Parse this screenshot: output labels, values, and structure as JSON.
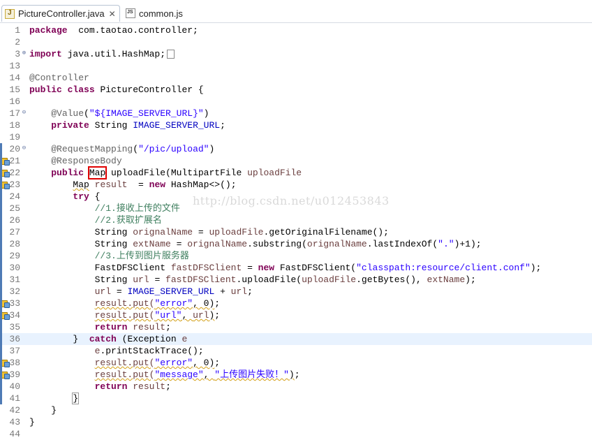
{
  "tabs": [
    {
      "label": "PictureController.java",
      "active": true,
      "icon": "java-file-icon",
      "close": "✕"
    },
    {
      "label": "common.js",
      "active": false,
      "icon": "js-file-icon"
    }
  ],
  "watermark": "http://blog.csdn.net/u012453843",
  "colors": {
    "keyword": "#7f0055",
    "string": "#2a00ff",
    "comment": "#3f7f5f",
    "field": "#0000c0",
    "highlight_box": "#e00000"
  },
  "lines": [
    {
      "n": "1",
      "t": [
        [
          "kw",
          "package"
        ],
        [
          "",
          "  com.taotao.controller;"
        ]
      ]
    },
    {
      "n": "2",
      "t": []
    },
    {
      "n": "3",
      "t": [
        [
          "kw",
          "import"
        ],
        [
          "",
          " java.util.HashMap;"
        ]
      ]
    },
    {
      "n": "13",
      "t": []
    },
    {
      "n": "14",
      "t": [
        [
          "ann",
          "@Controller"
        ]
      ]
    },
    {
      "n": "15",
      "t": [
        [
          "kw",
          "public"
        ],
        [
          "",
          " "
        ],
        [
          "kw",
          "class"
        ],
        [
          "",
          " PictureController {"
        ]
      ]
    },
    {
      "n": "16",
      "t": []
    },
    {
      "n": "17",
      "t": [
        [
          "",
          "    "
        ],
        [
          "ann",
          "@Value"
        ],
        [
          "",
          "("
        ],
        [
          "str",
          "\"${IMAGE_SERVER_URL}\""
        ],
        [
          "",
          ")"
        ]
      ]
    },
    {
      "n": "18",
      "t": [
        [
          "",
          "    "
        ],
        [
          "kw",
          "private"
        ],
        [
          "",
          " String "
        ],
        [
          "fld",
          "IMAGE_SERVER_URL"
        ],
        [
          "",
          ";"
        ]
      ]
    },
    {
      "n": "19",
      "t": []
    },
    {
      "n": "20",
      "t": [
        [
          "",
          "    "
        ],
        [
          "ann",
          "@RequestMapping"
        ],
        [
          "",
          "("
        ],
        [
          "str",
          "\"/pic/upload\""
        ],
        [
          "",
          ")"
        ]
      ]
    },
    {
      "n": "21",
      "t": [
        [
          "",
          "    "
        ],
        [
          "ann",
          "@ResponseBody"
        ]
      ]
    },
    {
      "n": "22",
      "t": [
        [
          "",
          "    "
        ],
        [
          "kw",
          "public"
        ],
        [
          "",
          " "
        ],
        [
          "box",
          "Map"
        ],
        [
          "",
          " uploadFile(MultipartFile "
        ],
        [
          "var",
          "uploadFile"
        ],
        [
          ") {"
        ]
      ]
    },
    {
      "n": "23",
      "t": [
        [
          "",
          "        "
        ],
        [
          "warn",
          "Map"
        ],
        [
          "",
          " "
        ],
        [
          "var",
          "result"
        ],
        [
          "",
          "  = "
        ],
        [
          "kw",
          "new"
        ],
        [
          "",
          " HashMap<>();"
        ]
      ]
    },
    {
      "n": "24",
      "t": [
        [
          "",
          "        "
        ],
        [
          "kw",
          "try"
        ],
        [
          "",
          " {"
        ]
      ]
    },
    {
      "n": "25",
      "t": [
        [
          "",
          "            "
        ],
        [
          "cm",
          "//1.接收上传的文件"
        ]
      ]
    },
    {
      "n": "26",
      "t": [
        [
          "",
          "            "
        ],
        [
          "cm",
          "//2.获取扩展名"
        ]
      ]
    },
    {
      "n": "27",
      "t": [
        [
          "",
          "            String "
        ],
        [
          "var",
          "orignalName"
        ],
        [
          "",
          " = "
        ],
        [
          "var",
          "uploadFile"
        ],
        [
          "",
          ".getOriginalFilename();"
        ]
      ]
    },
    {
      "n": "28",
      "t": [
        [
          "",
          "            String "
        ],
        [
          "var",
          "extName"
        ],
        [
          "",
          " = "
        ],
        [
          "var",
          "orignalName"
        ],
        [
          "",
          ".substring("
        ],
        [
          "var",
          "orignalName"
        ],
        [
          "",
          ".lastIndexOf("
        ],
        [
          "str",
          "\".\""
        ],
        [
          "",
          ")+1);"
        ]
      ]
    },
    {
      "n": "29",
      "t": [
        [
          "",
          "            "
        ],
        [
          "cm",
          "//3.上传到图片服务器"
        ]
      ]
    },
    {
      "n": "30",
      "t": [
        [
          "",
          "            FastDFSClient "
        ],
        [
          "var",
          "fastDFSClient"
        ],
        [
          "",
          " = "
        ],
        [
          "kw",
          "new"
        ],
        [
          "",
          " FastDFSClient("
        ],
        [
          "str",
          "\"classpath:resource/client.conf\""
        ],
        [
          "",
          ");"
        ]
      ]
    },
    {
      "n": "31",
      "t": [
        [
          "",
          "            String "
        ],
        [
          "var",
          "url"
        ],
        [
          "",
          " = "
        ],
        [
          "var",
          "fastDFSClient"
        ],
        [
          "",
          ".uploadFile("
        ],
        [
          "var",
          "uploadFile"
        ],
        [
          "",
          ".getBytes(), "
        ],
        [
          "var",
          "extName"
        ],
        [
          "",
          ");"
        ]
      ]
    },
    {
      "n": "32",
      "t": [
        [
          "",
          "            "
        ],
        [
          "var",
          "url"
        ],
        [
          "",
          " = "
        ],
        [
          "fld",
          "IMAGE_SERVER_URL"
        ],
        [
          "",
          " + "
        ],
        [
          "var",
          "url"
        ],
        [
          "",
          ";"
        ]
      ]
    },
    {
      "n": "33",
      "t": [
        [
          "",
          "            "
        ],
        [
          "wvar",
          "result.put("
        ],
        [
          "wstr",
          "\"error\""
        ],
        [
          "warn",
          ", 0)"
        ],
        [
          "",
          ";"
        ]
      ]
    },
    {
      "n": "34",
      "t": [
        [
          "",
          "            "
        ],
        [
          "wvar",
          "result.put("
        ],
        [
          "wstr",
          "\"url\""
        ],
        [
          "warn",
          ", "
        ],
        [
          "wvar",
          "url"
        ],
        [
          "warn",
          ")"
        ],
        [
          "",
          ";"
        ]
      ]
    },
    {
      "n": "35",
      "t": [
        [
          "",
          "            "
        ],
        [
          "kw",
          "return"
        ],
        [
          "",
          " "
        ],
        [
          "var",
          "result"
        ],
        [
          "",
          ";"
        ]
      ]
    },
    {
      "n": "36",
      "t": [
        [
          "",
          "        }  "
        ],
        [
          "kw",
          "catch"
        ],
        [
          "",
          " (Exception "
        ],
        [
          "var",
          "e"
        ],
        [
          ") {"
        ]
      ]
    },
    {
      "n": "37",
      "t": [
        [
          "",
          "            "
        ],
        [
          "var",
          "e"
        ],
        [
          "",
          ".printStackTrace();"
        ]
      ]
    },
    {
      "n": "38",
      "t": [
        [
          "",
          "            "
        ],
        [
          "wvar",
          "result.put("
        ],
        [
          "wstr",
          "\"error\""
        ],
        [
          "warn",
          ", 0)"
        ],
        [
          "",
          ";"
        ]
      ]
    },
    {
      "n": "39",
      "t": [
        [
          "",
          "            "
        ],
        [
          "wvar",
          "result.put("
        ],
        [
          "wstr",
          "\"message\""
        ],
        [
          "warn",
          ", "
        ],
        [
          "wstr",
          "\"上传图片失败！\""
        ],
        [
          "warn",
          ")"
        ],
        [
          "",
          ";"
        ]
      ]
    },
    {
      "n": "40",
      "t": [
        [
          "",
          "            "
        ],
        [
          "kw",
          "return"
        ],
        [
          "",
          " "
        ],
        [
          "var",
          "result"
        ],
        [
          "",
          ";"
        ]
      ]
    },
    {
      "n": "41",
      "t": [
        [
          "",
          "        "
        ],
        [
          "bracket",
          "}"
        ]
      ]
    },
    {
      "n": "42",
      "t": [
        [
          "",
          "    }"
        ]
      ]
    },
    {
      "n": "43",
      "t": [
        [
          "",
          "}"
        ]
      ]
    },
    {
      "n": "44",
      "t": []
    }
  ]
}
